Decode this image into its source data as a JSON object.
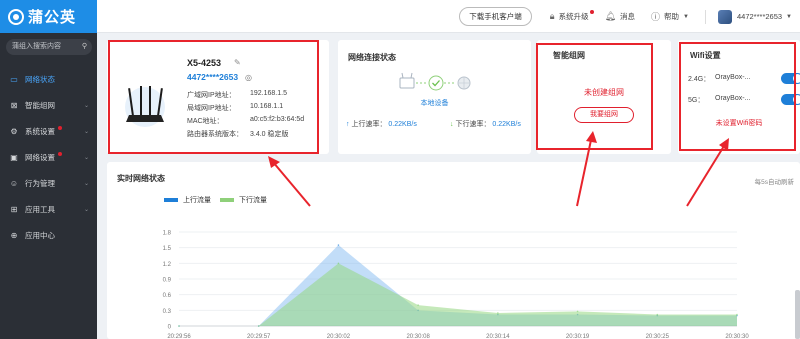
{
  "app": {
    "logo_text": "蒲公英"
  },
  "topbar": {
    "download_label": "下载手机客户端",
    "upgrade_label": "系统升级",
    "messages_label": "消息",
    "help_label": "帮助",
    "account": "4472****2653"
  },
  "sidebar": {
    "search_placeholder": "蒲组入搜索内容",
    "items": [
      {
        "label": "网络状态",
        "icon": "monitor-icon",
        "active": true
      },
      {
        "label": "智能组网",
        "icon": "mesh-icon"
      },
      {
        "label": "系统设置",
        "icon": "gear-icon",
        "badge": true
      },
      {
        "label": "网络设置",
        "icon": "network-icon",
        "badge": true
      },
      {
        "label": "行为管理",
        "icon": "user-icon"
      },
      {
        "label": "应用工具",
        "icon": "toolbox-icon"
      },
      {
        "label": "应用中心",
        "icon": "apps-icon"
      }
    ]
  },
  "device": {
    "name": "X5-4253",
    "id": "4472****2653",
    "wan_ip_label": "广域网IP地址：",
    "wan_ip": "192.168.1.5",
    "lan_ip_label": "局域网IP地址：",
    "lan_ip": "10.168.1.1",
    "mac_label": "MAC地址：",
    "mac": "a0:c5:f2:b3:64:5d",
    "fw_label": "路由器系统版本：",
    "fw": "3.4.0 稳定版"
  },
  "network_status": {
    "title": "网络连接状态",
    "local_device": "本地设备",
    "up_label": "上行速率：",
    "up_value": "0.22KB/s",
    "down_label": "下行速率：",
    "down_value": "0.22KB/s"
  },
  "mesh": {
    "title": "智能组网",
    "status": "未创建组网",
    "button": "我要组网"
  },
  "wifi": {
    "title": "Wifi设置",
    "rows": [
      {
        "band": "2.4G：",
        "ssid": "OrayBox-...",
        "on": true
      },
      {
        "band": "5G：",
        "ssid": "OrayBox-...",
        "on": true
      }
    ],
    "warning": "未设置Wifi密码"
  },
  "realtime": {
    "title": "实时网络状态",
    "note": "每5s自动刷新"
  },
  "chart_data": {
    "type": "area",
    "title": "实时网络状态",
    "x": [
      "20:29:56",
      "20:29:57",
      "20:30:02",
      "20:30:08",
      "20:30:14",
      "20:30:19",
      "20:30:25",
      "20:30:30"
    ],
    "ylim": [
      0,
      1.8
    ],
    "yticks": [
      "1.8",
      "1.5",
      "1.2",
      "0.9",
      "0.6",
      "0.3",
      "0"
    ],
    "series": [
      {
        "name": "上行流量",
        "color": "#1e7fd8",
        "values": [
          0,
          0,
          1.55,
          0.3,
          0.22,
          0.22,
          0.2,
          0.2
        ]
      },
      {
        "name": "下行流量",
        "color": "#7ed06b",
        "values": [
          0,
          0,
          1.2,
          0.4,
          0.25,
          0.28,
          0.22,
          0.22
        ]
      }
    ]
  }
}
